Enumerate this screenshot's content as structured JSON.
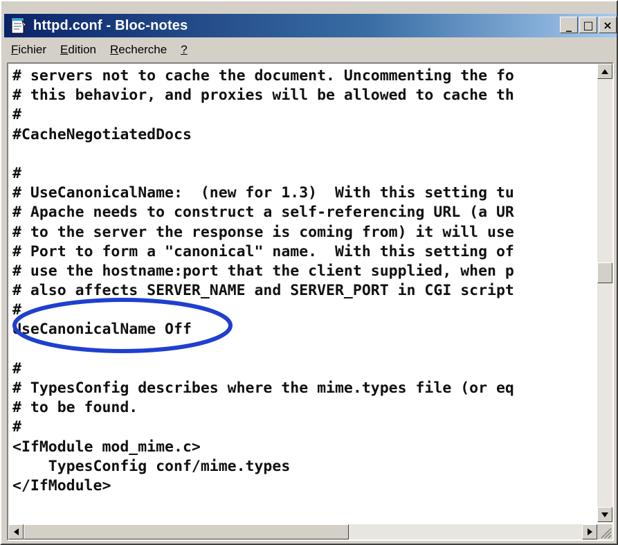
{
  "window": {
    "title": "httpd.conf - Bloc-notes",
    "controls": {
      "minimize_glyph": "_",
      "maximize_glyph": "□",
      "close_glyph": "×"
    }
  },
  "menu": [
    {
      "mnemonic": "F",
      "rest": "ichier"
    },
    {
      "mnemonic": "E",
      "rest": "dition"
    },
    {
      "mnemonic": "R",
      "rest": "echerche"
    },
    {
      "mnemonic": "?",
      "rest": ""
    }
  ],
  "document": {
    "lines": [
      "# servers not to cache the document. Uncommenting the fo",
      "# this behavior, and proxies will be allowed to cache th",
      "#",
      "#CacheNegotiatedDocs",
      "",
      "#",
      "# UseCanonicalName:  (new for 1.3)  With this setting tu",
      "# Apache needs to construct a self-referencing URL (a UR",
      "# to the server the response is coming from) it will use",
      "# Port to form a \"canonical\" name.  With this setting of",
      "# use the hostname:port that the client supplied, when p",
      "# also affects SERVER_NAME and SERVER_PORT in CGI script",
      "#",
      "UseCanonicalName Off",
      "",
      "#",
      "# TypesConfig describes where the mime.types file (or eq",
      "# to be found.",
      "#",
      "<IfModule mod_mime.c>",
      "    TypesConfig conf/mime.types",
      "</IfModule>"
    ],
    "highlighted_line": "UseCanonicalName Off"
  },
  "icons": {
    "app": "notepad-icon",
    "scroll_up": "arrow-up-icon",
    "scroll_down": "arrow-down-icon",
    "scroll_left": "arrow-left-icon",
    "scroll_right": "arrow-right-icon"
  },
  "colors": {
    "title_gradient_start": "#0a246a",
    "title_gradient_end": "#a6caf0",
    "highlight_ellipse": "#1f3fd0"
  },
  "scroll": {
    "vertical_fraction": 0.45,
    "horizontal_fraction": 0.0
  }
}
